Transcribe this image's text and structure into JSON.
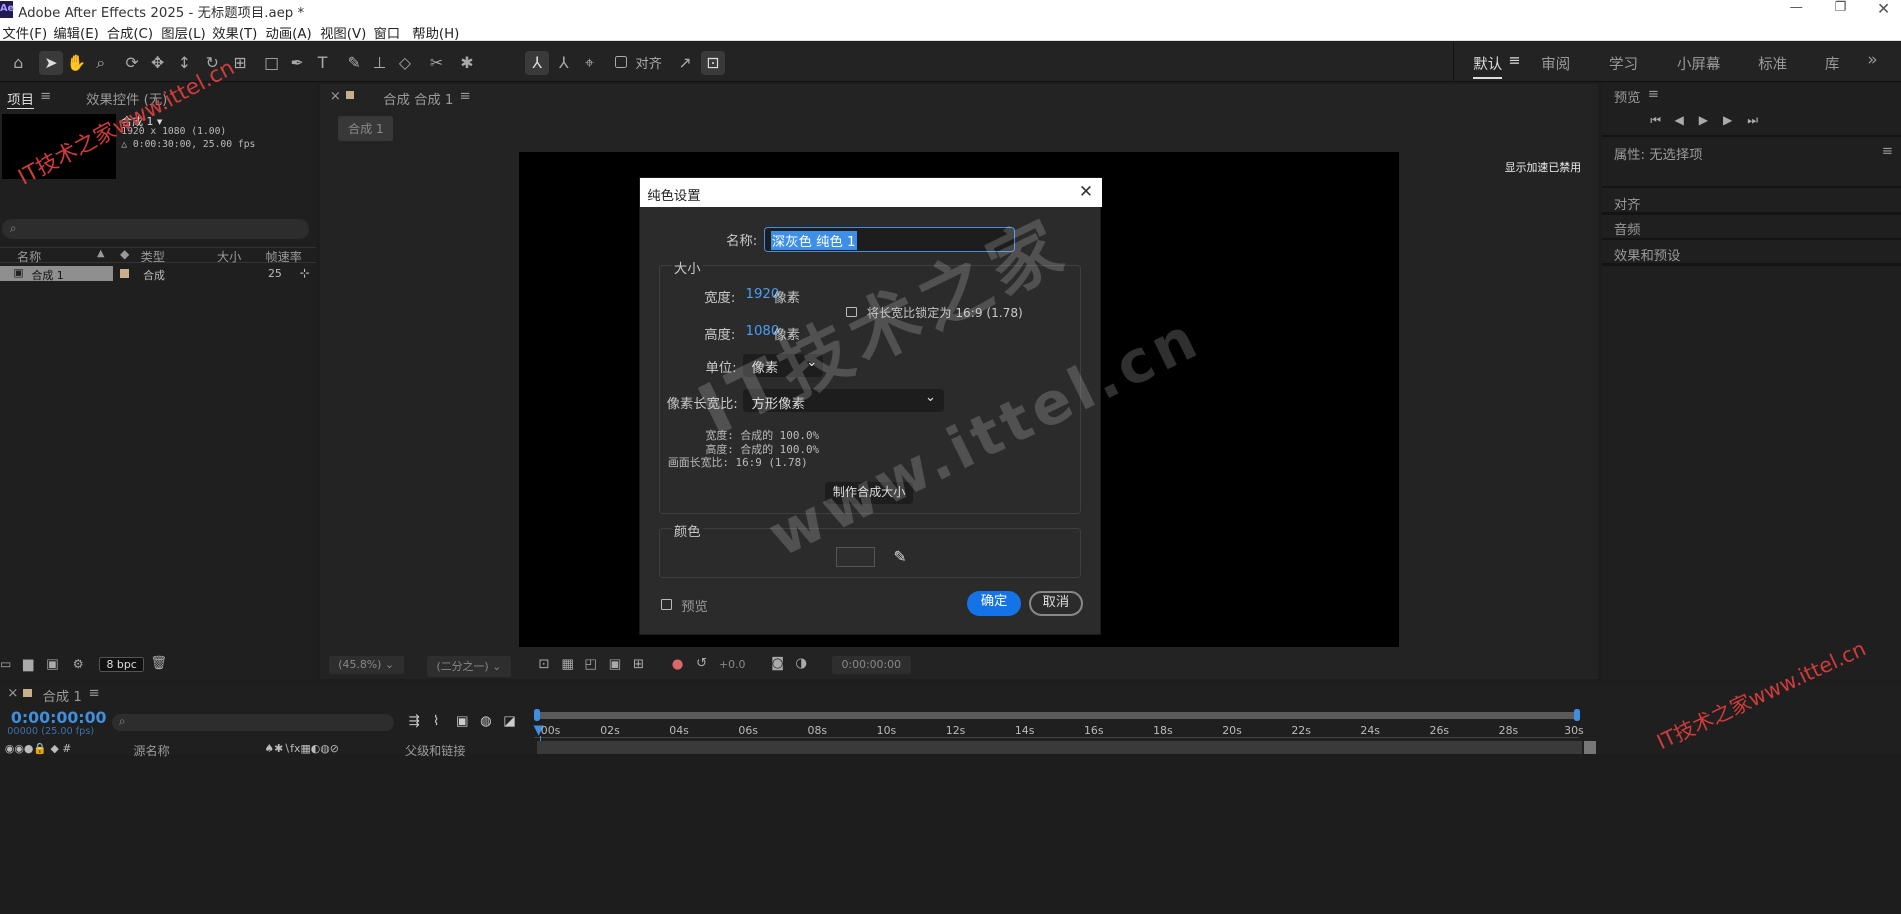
{
  "window": {
    "app_badge": "Ae",
    "title": "Adobe After Effects 2025 - 无标题项目.aep *"
  },
  "menu": [
    "文件(F)",
    "编辑(E)",
    "合成(C)",
    "图层(L)",
    "效果(T)",
    "动画(A)",
    "视图(V)",
    "窗口",
    "帮助(H)"
  ],
  "toolbar": {
    "snap_label": "对齐",
    "workspaces": [
      "默认",
      "审阅",
      "学习",
      "小屏幕",
      "标准",
      "库"
    ],
    "more": "»"
  },
  "project_panel": {
    "tab_project": "项目",
    "tab_effects": "效果控件 (无)",
    "comp_name": "合成 1",
    "comp_res": "1920 x 1080 (1.00)",
    "comp_duration": "△ 0:00:30:00, 25.00 fps",
    "search_placeholder": "",
    "col_name": "名称",
    "col_type": "类型",
    "col_size": "大小",
    "col_fps": "帧速率",
    "row_name": "合成 1",
    "row_type": "合成",
    "row_fps": "25",
    "bpc": "8 bpc"
  },
  "comp_panel": {
    "tab": "合成 合成 1",
    "crumb": "合成 1",
    "gpu_notice": "显示加速已禁用",
    "zoom": "(45.8%)",
    "resolution": "(二分之一)",
    "exposure": "+0.0",
    "timecode": "0:00:00:00"
  },
  "right_panel": {
    "preview": "预览",
    "properties": "属性: 无选择项",
    "align": "对齐",
    "audio": "音频",
    "effects_presets": "效果和预设"
  },
  "timeline": {
    "tab": "合成 1",
    "timecode": "0:00:00:00",
    "timecode_sub": "00000 (25.00 fps)",
    "col_source": "源名称",
    "col_parent": "父级和链接",
    "ruler": [
      "00s",
      "02s",
      "04s",
      "06s",
      "08s",
      "10s",
      "12s",
      "14s",
      "16s",
      "18s",
      "20s",
      "22s",
      "24s",
      "26s",
      "28s",
      "30s"
    ]
  },
  "dialog": {
    "title": "纯色设置",
    "name_label": "名称:",
    "name_value": "深灰色 纯色 1",
    "size_group": "大小",
    "width_label": "宽度:",
    "width_value": "1920",
    "width_unit": "像素",
    "height_label": "高度:",
    "height_value": "1080",
    "height_unit": "像素",
    "lock_label": "将长宽比锁定为 16:9 (1.78)",
    "units_label": "单位:",
    "units_value": "像素",
    "par_label": "像素长宽比:",
    "par_value": "方形像素",
    "info_width": "宽度: 合成的 100.0%",
    "info_height": "高度: 合成的 100.0%",
    "info_aspect": "画面长宽比: 16:9 (1.78)",
    "make_comp_size": "制作合成大小",
    "color_group": "颜色",
    "swatch_color": "#2e2e2e",
    "preview_label": "预览",
    "ok": "确定",
    "cancel": "取消"
  },
  "watermarks": {
    "main_1": "IT技术之家",
    "main_2": "www.ittel.cn",
    "corner_1": "IT技术之家www.ittel.cn",
    "corner_2": "IT技术之家www.ittel.cn"
  }
}
